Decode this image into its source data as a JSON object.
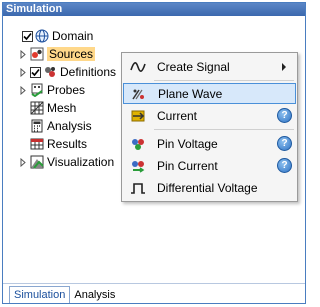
{
  "panel": {
    "title": "Simulation"
  },
  "tree": {
    "items": [
      {
        "label": "Domain",
        "checked": true,
        "expandable": false
      },
      {
        "label": "Sources",
        "checked": null,
        "expandable": true,
        "selected": true
      },
      {
        "label": "Definitions",
        "checked": true,
        "expandable": true
      },
      {
        "label": "Probes",
        "checked": null,
        "expandable": true
      },
      {
        "label": "Mesh",
        "checked": null,
        "expandable": false
      },
      {
        "label": "Analysis",
        "checked": null,
        "expandable": false
      },
      {
        "label": "Results",
        "checked": null,
        "expandable": false
      },
      {
        "label": "Visualization",
        "checked": null,
        "expandable": true
      }
    ]
  },
  "context_menu": {
    "items": [
      {
        "label": "Create Signal",
        "icon": "signal-wave-icon",
        "submenu": true
      },
      {
        "label": "Plane Wave",
        "icon": "plane-wave-icon",
        "highlighted": true
      },
      {
        "label": "Current",
        "icon": "current-source-icon",
        "help": true
      },
      {
        "label": "Pin Voltage",
        "icon": "pin-voltage-icon",
        "help": true
      },
      {
        "label": "Pin Current",
        "icon": "pin-current-icon",
        "help": true
      },
      {
        "label": "Differential Voltage",
        "icon": "differential-voltage-icon"
      }
    ],
    "help_glyph": "?"
  },
  "tabs": {
    "items": [
      {
        "label": "Simulation",
        "active": true
      },
      {
        "label": "Analysis",
        "active": false
      }
    ]
  }
}
